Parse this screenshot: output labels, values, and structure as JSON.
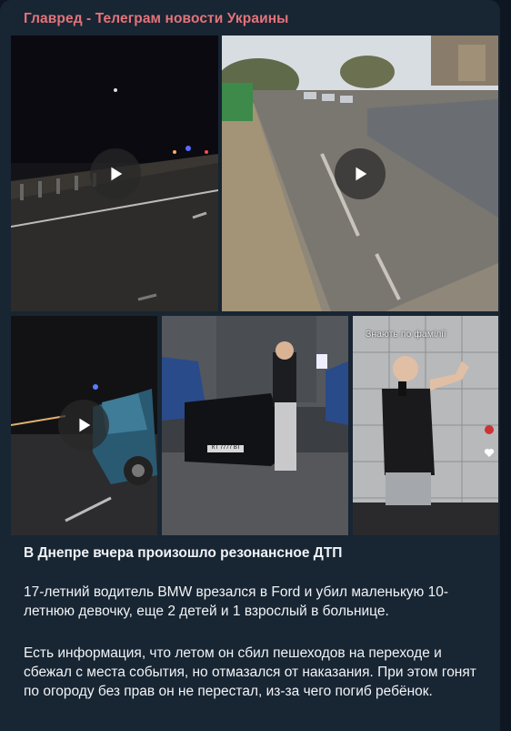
{
  "channel": {
    "name": "Главред - Телеграм новости Украины",
    "color": "#e4737a"
  },
  "media": [
    {
      "kind": "video",
      "description_icon": "play-icon"
    },
    {
      "kind": "video",
      "description_icon": "play-icon"
    },
    {
      "kind": "video",
      "description_icon": "play-icon"
    },
    {
      "kind": "photo",
      "plate": "КТ 7777 ВТ"
    },
    {
      "kind": "photo",
      "overlay": "Знають по фамілії"
    }
  ],
  "post": {
    "title": "В Днепре вчера произошло резонансное ДТП",
    "paragraph1": "17-летний водитель BMW врезался в Ford и убил маленькую 10-летнюю девочку, еще 2 детей и 1 взрослый в больнице.",
    "paragraph2": "Есть информация, что летом он сбил пешеходов на переходе и сбежал с места события, но отмазался от наказания. При этом гонят по огороду без прав он не перестал, из-за чего погиб ребёнок."
  }
}
